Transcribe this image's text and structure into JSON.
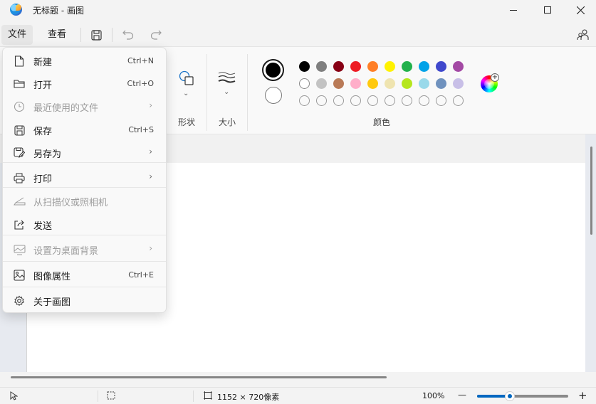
{
  "window": {
    "title": "无标题 - 画图",
    "icon": "paint-app-icon"
  },
  "menubar": {
    "file": "文件",
    "view": "查看",
    "icons": [
      "save-icon",
      "undo-icon",
      "redo-icon",
      "account-icon"
    ]
  },
  "ribbon": {
    "shapes_label": "形状",
    "size_label": "大小",
    "colors_label": "颜色",
    "color1": "#000000",
    "color2": "#ffffff",
    "palette_row1": [
      "#000000",
      "#7f7f7f",
      "#880015",
      "#ed1c24",
      "#ff7f27",
      "#fff200",
      "#22b14c",
      "#00a2e8",
      "#3f48cc",
      "#a349a4"
    ],
    "palette_row2": [
      "#ffffff",
      "#c3c3c3",
      "#b97a57",
      "#ffaec9",
      "#ffc90e",
      "#efe4b0",
      "#b5e61d",
      "#99d9ea",
      "#7092be",
      "#c8bfe7"
    ]
  },
  "file_menu": {
    "items": [
      {
        "label": "新建",
        "shortcut": "Ctrl+N",
        "icon": "new-file-icon",
        "enabled": true
      },
      {
        "label": "打开",
        "shortcut": "Ctrl+O",
        "icon": "open-folder-icon",
        "enabled": true
      },
      {
        "label": "最近使用的文件",
        "shortcut": "",
        "icon": "clock-icon",
        "enabled": false,
        "submenu": true
      },
      {
        "label": "保存",
        "shortcut": "Ctrl+S",
        "icon": "save-icon",
        "enabled": true
      },
      {
        "label": "另存为",
        "shortcut": "",
        "icon": "save-as-icon",
        "enabled": true,
        "submenu": true
      },
      {
        "label": "打印",
        "shortcut": "",
        "icon": "printer-icon",
        "enabled": true,
        "submenu": true
      },
      {
        "label": "从扫描仪或照相机",
        "shortcut": "",
        "icon": "scanner-icon",
        "enabled": false
      },
      {
        "label": "发送",
        "shortcut": "",
        "icon": "share-icon",
        "enabled": true
      },
      {
        "label": "设置为桌面背景",
        "shortcut": "",
        "icon": "desktop-background-icon",
        "enabled": false,
        "submenu": true
      },
      {
        "label": "图像属性",
        "shortcut": "Ctrl+E",
        "icon": "image-properties-icon",
        "enabled": true
      },
      {
        "label": "关于画图",
        "shortcut": "",
        "icon": "gear-icon",
        "enabled": true
      }
    ],
    "arrow": "›"
  },
  "statusbar": {
    "canvas_size": "1152 × 720像素",
    "zoom": "100%",
    "zoom_minus": "—",
    "zoom_plus": "+",
    "zoom_level": 0.36
  }
}
